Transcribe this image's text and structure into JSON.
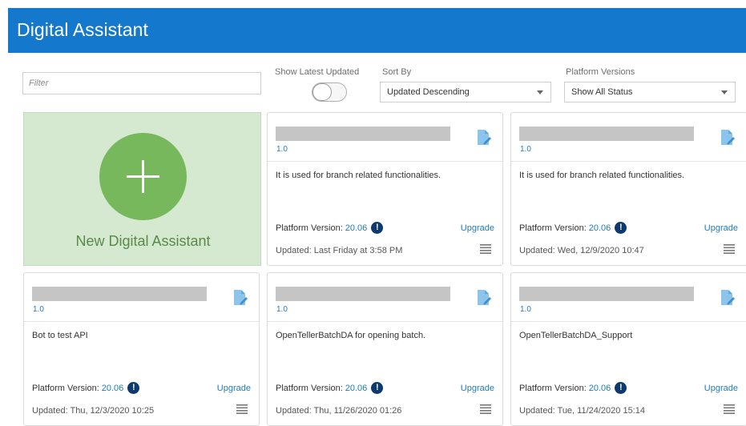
{
  "header": {
    "title": "Digital Assistant"
  },
  "filter": {
    "placeholder": "Filter",
    "value": ""
  },
  "show_latest": {
    "label": "Show Latest Updated",
    "on": false
  },
  "sort": {
    "label": "Sort By",
    "value": "Updated Descending"
  },
  "platform_versions": {
    "label": "Platform Versions",
    "value": "Show All Status"
  },
  "new_card": {
    "label": "New Digital Assistant"
  },
  "common": {
    "platform_label": "Platform Version:",
    "upgrade": "Upgrade",
    "warn_glyph": "!"
  },
  "cards": [
    {
      "version": "1.0",
      "description": "It is used for branch related functionalities.",
      "platform_version": "20.06",
      "updated": "Updated: Last Friday at 3:58 PM"
    },
    {
      "version": "1.0",
      "description": "It is used for branch related functionalities.",
      "platform_version": "20.06",
      "updated": "Updated: Wed, 12/9/2020 10:47"
    },
    {
      "version": "1.0",
      "description": "Bot to test API",
      "platform_version": "20.06",
      "updated": "Updated: Thu, 12/3/2020 10:25"
    },
    {
      "version": "1.0",
      "description": "OpenTellerBatchDA for opening batch.",
      "platform_version": "20.06",
      "updated": "Updated: Thu, 11/26/2020 01:26"
    },
    {
      "version": "1.0",
      "description": "OpenTellerBatchDA_Support",
      "platform_version": "20.06",
      "updated": "Updated: Tue, 11/24/2020 15:14"
    }
  ],
  "colors": {
    "header": "#1479cc",
    "accent": "#1f7ac2",
    "new_card_bg": "#d5e8d0",
    "plus": "#77b85d"
  },
  "icons": {
    "card_icon": "document-edit-icon",
    "menu": "menu-lines-icon",
    "add": "plus-icon",
    "warning": "exclamation-icon"
  }
}
